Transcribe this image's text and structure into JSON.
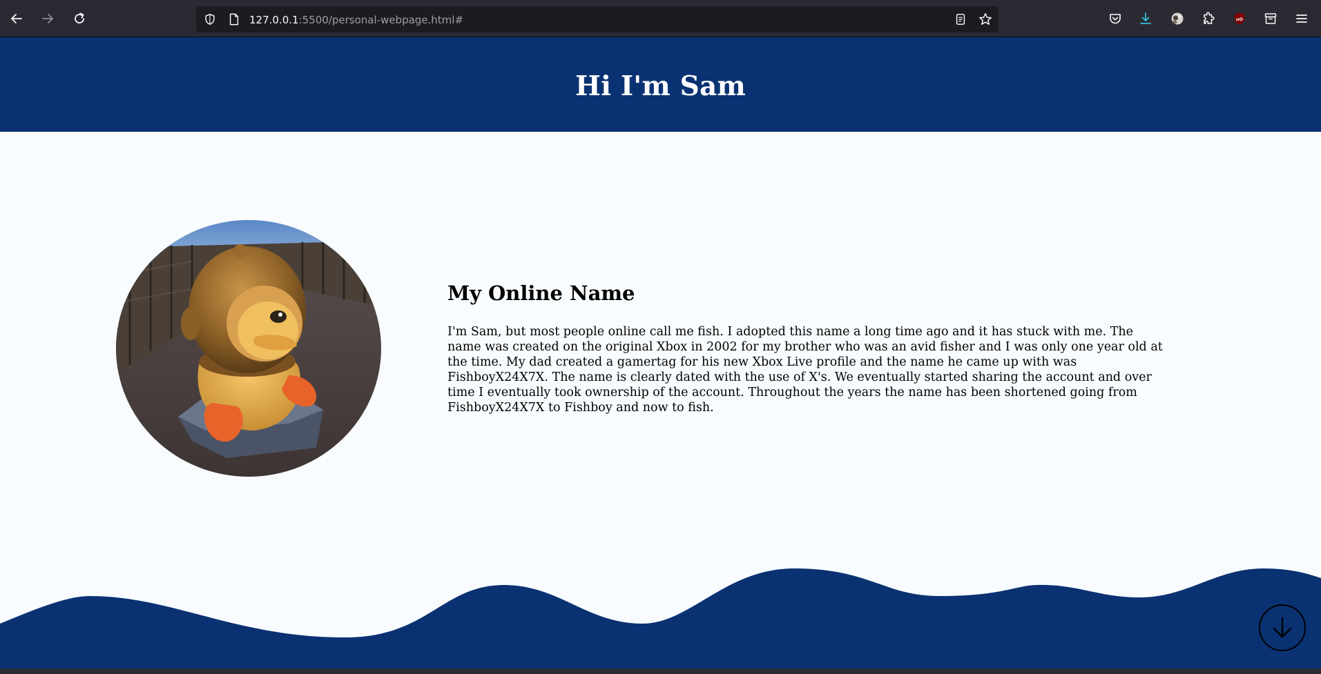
{
  "browser": {
    "url_host": "127.0.0.1",
    "url_rest": ":5500/personal-webpage.html#",
    "icons": {
      "back": "arrow-left-icon",
      "forward": "arrow-right-icon",
      "reload": "reload-icon",
      "tracking": "shield-icon",
      "page": "page-icon",
      "reader": "reader-view-icon",
      "bookmark": "star-icon",
      "pocket": "pocket-icon",
      "downloads": "download-icon",
      "account": "avatar-icon",
      "extensions": "puzzle-icon",
      "ublock": "ublock-icon",
      "containers": "containers-icon",
      "menu": "hamburger-menu-icon"
    }
  },
  "site": {
    "title": "Hi I'm Sam",
    "about_heading": "My Online Name",
    "about_text": "I'm Sam, but most people online call me fish. I adopted this name a long time ago and it has stuck with me. The name was created on the original Xbox in 2002 for my brother who was an avid fisher and I was only one year old at the time. My dad created a gamertag for his new Xbox Live profile and the name he came up with was FishboyX24X7X. The name is clearly dated with the use of X's. We eventually started sharing the account and over time I eventually took ownership of the account. Throughout the years the name has been shortened going from FishboyX24X7X to Fishboy and now to fish.",
    "scroll_icon": "arrow-down-circle-icon"
  },
  "colors": {
    "navy": "#0a3272",
    "page_bg": "#f8fcff",
    "chrome_bg": "#2b2a33",
    "url_bg": "#1c1b22",
    "download_accent": "#30bfdc",
    "ublock_red": "#800000"
  }
}
